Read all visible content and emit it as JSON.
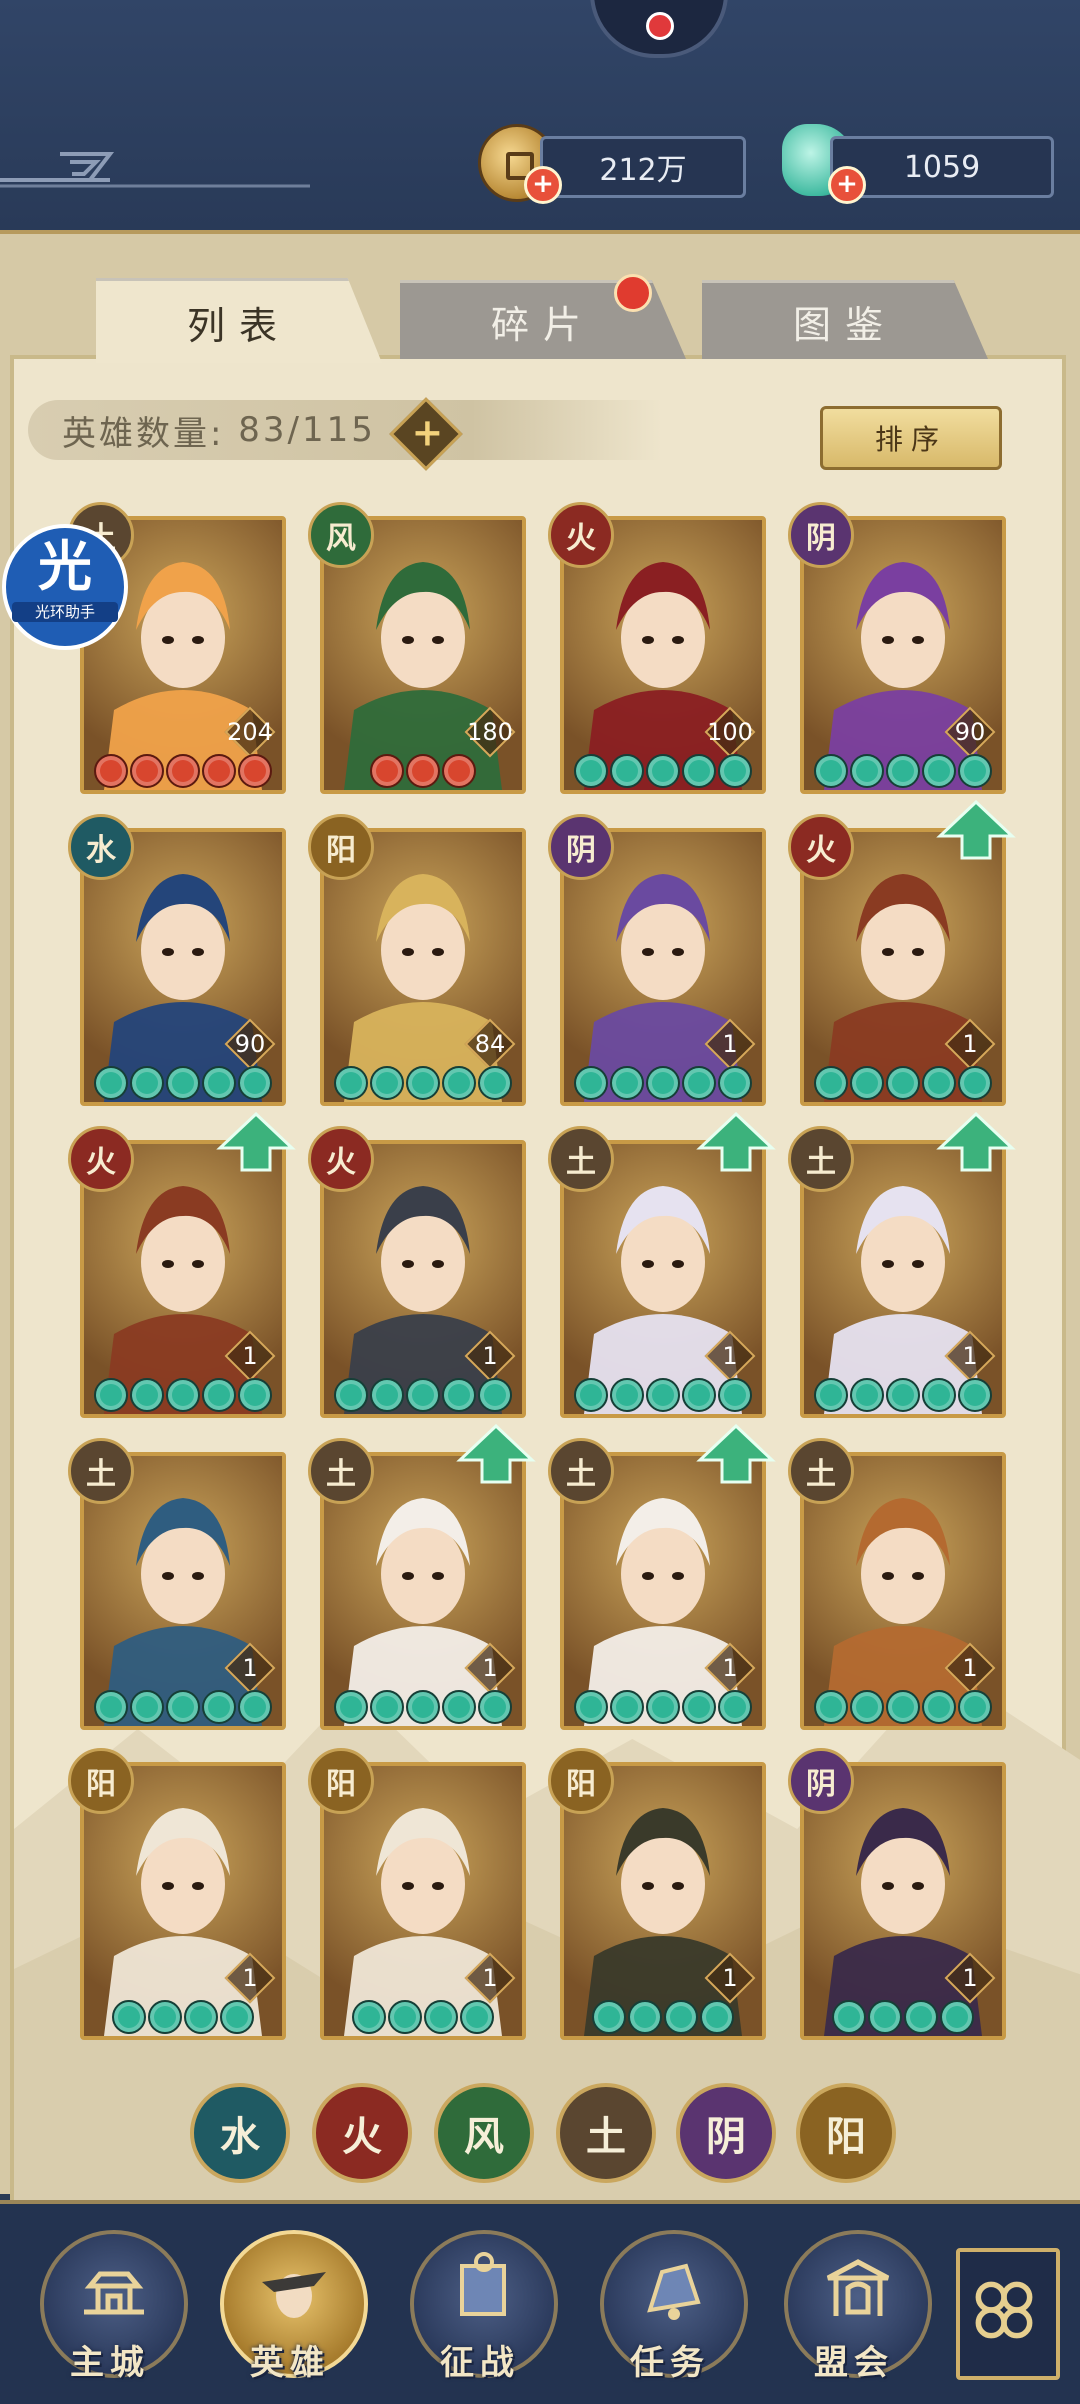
{
  "resources": {
    "coins": "212万",
    "gems": "1059"
  },
  "tabs": [
    {
      "label": "列表",
      "active": true
    },
    {
      "label": "碎片",
      "active": false,
      "has_notice": true
    },
    {
      "label": "图鉴",
      "active": false
    }
  ],
  "hero_count": {
    "label": "英雄数量:",
    "value": "83/115"
  },
  "sort_label": "排序",
  "watermark": {
    "glyph": "光",
    "text": "光环助手"
  },
  "heroes": [
    {
      "element": "土",
      "level": "204",
      "stars": 5,
      "star_color": "red",
      "upgradable": false
    },
    {
      "element": "风",
      "level": "180",
      "stars": 3,
      "star_color": "red",
      "upgradable": false
    },
    {
      "element": "火",
      "level": "100",
      "stars": 5,
      "star_color": "green",
      "upgradable": false
    },
    {
      "element": "阴",
      "level": "90",
      "stars": 5,
      "star_color": "green",
      "upgradable": false
    },
    {
      "element": "水",
      "level": "90",
      "stars": 5,
      "star_color": "green",
      "upgradable": false
    },
    {
      "element": "阳",
      "level": "84",
      "stars": 5,
      "star_color": "green",
      "upgradable": false
    },
    {
      "element": "阴",
      "level": "1",
      "stars": 5,
      "star_color": "green",
      "upgradable": false
    },
    {
      "element": "火",
      "level": "1",
      "stars": 5,
      "star_color": "green",
      "upgradable": true
    },
    {
      "element": "火",
      "level": "1",
      "stars": 5,
      "star_color": "green",
      "upgradable": true
    },
    {
      "element": "火",
      "level": "1",
      "stars": 5,
      "star_color": "green",
      "upgradable": false
    },
    {
      "element": "土",
      "level": "1",
      "stars": 5,
      "star_color": "green",
      "upgradable": true
    },
    {
      "element": "土",
      "level": "1",
      "stars": 5,
      "star_color": "green",
      "upgradable": true
    },
    {
      "element": "土",
      "level": "1",
      "stars": 5,
      "star_color": "green",
      "upgradable": false
    },
    {
      "element": "土",
      "level": "1",
      "stars": 5,
      "star_color": "green",
      "upgradable": true
    },
    {
      "element": "土",
      "level": "1",
      "stars": 5,
      "star_color": "green",
      "upgradable": true
    },
    {
      "element": "土",
      "level": "1",
      "stars": 5,
      "star_color": "green",
      "upgradable": false
    },
    {
      "element": "阳",
      "level": "1",
      "stars": 4,
      "star_color": "green",
      "upgradable": false
    },
    {
      "element": "阳",
      "level": "1",
      "stars": 4,
      "star_color": "green",
      "upgradable": false
    },
    {
      "element": "阳",
      "level": "1",
      "stars": 4,
      "star_color": "green",
      "upgradable": false
    },
    {
      "element": "阴",
      "level": "1",
      "stars": 4,
      "star_color": "green",
      "upgradable": false
    }
  ],
  "element_colors": {
    "水": "#1f5a63",
    "火": "#8b2a22",
    "风": "#2f6b3a",
    "土": "#5a4630",
    "阴": "#5a3470",
    "阳": "#8a6322"
  },
  "element_filters": [
    "水",
    "火",
    "风",
    "土",
    "阴",
    "阳"
  ],
  "nav": [
    {
      "label": "主城",
      "icon": "city-gate-icon",
      "active": false
    },
    {
      "label": "英雄",
      "icon": "hero-portrait-icon",
      "active": true
    },
    {
      "label": "征战",
      "icon": "campaign-scroll-icon",
      "active": false
    },
    {
      "label": "任务",
      "icon": "task-bell-icon",
      "active": false
    },
    {
      "label": "盟会",
      "icon": "alliance-pavilion-icon",
      "active": false
    }
  ],
  "menu_icon": "menu-knot-icon"
}
